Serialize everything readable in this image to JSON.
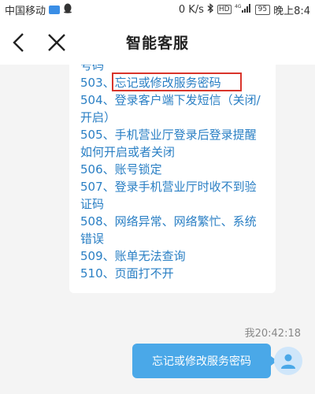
{
  "status_bar": {
    "carrier": "中国移动",
    "speed": "0 K/s",
    "hd": "HD",
    "network": "4G",
    "battery": "95",
    "time": "晚上8:4"
  },
  "header": {
    "title": "智能客服"
  },
  "faq": {
    "items": [
      "号码",
      "503、忘记或修改服务密码",
      "504、登录客户端下发短信（关闭/",
      "开启）",
      "505、手机营业厅登录后登录提醒",
      "如何开启或者关闭",
      "506、账号锁定",
      "507、登录手机营业厅时收不到验",
      "证码",
      "508、网络异常、网络繁忙、系统",
      "错误",
      "509、账单无法查询",
      "510、页面打不开"
    ],
    "highlight_color": "#d9342b",
    "link_color": "#2a7fc4"
  },
  "chat": {
    "timestamp": "我20:42:18",
    "user_message": "忘记或修改服务密码",
    "bubble_color": "#4aa8e8"
  }
}
